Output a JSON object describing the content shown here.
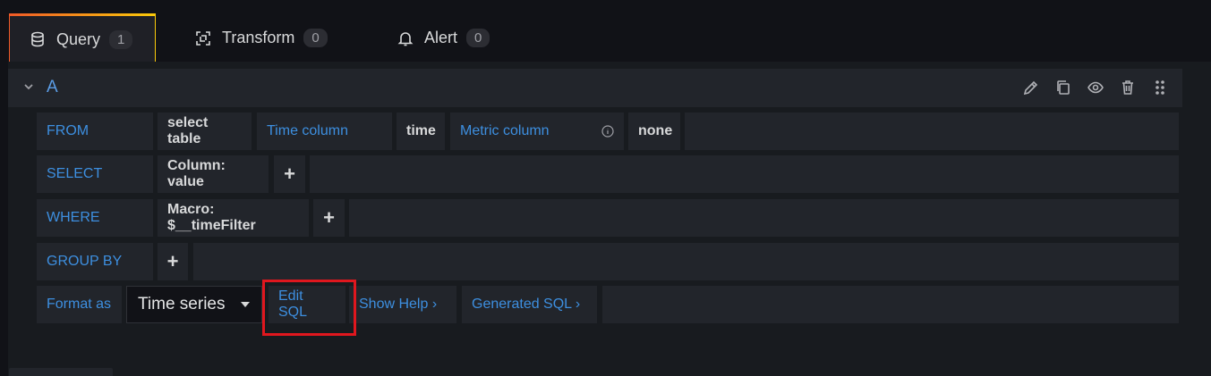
{
  "tabs": [
    {
      "label": "Query",
      "count": "1",
      "icon": "database-icon"
    },
    {
      "label": "Transform",
      "count": "0",
      "icon": "transform-icon"
    },
    {
      "label": "Alert",
      "count": "0",
      "icon": "bell-icon"
    }
  ],
  "query": {
    "name": "A",
    "actions": [
      "edit-icon",
      "duplicate-icon",
      "eye-icon",
      "trash-icon",
      "drag-handle-icon"
    ]
  },
  "builder": {
    "from": {
      "label": "FROM",
      "table": "select table",
      "time_column_label": "Time column",
      "time_column": "time",
      "metric_column_label": "Metric column",
      "metric_column": "none"
    },
    "select": {
      "label": "SELECT",
      "column": "Column: value",
      "add": "+"
    },
    "where": {
      "label": "WHERE",
      "macro": "Macro: $__timeFilter",
      "add": "+"
    },
    "group_by": {
      "label": "GROUP BY",
      "add": "+"
    },
    "format": {
      "label": "Format as",
      "value": "Time series",
      "edit_sql": "Edit SQL",
      "show_help": "Show Help ›",
      "generated_sql": "Generated SQL ›"
    }
  },
  "colors": {
    "accent": "#3d8fe0",
    "highlight": "#e0171e"
  }
}
